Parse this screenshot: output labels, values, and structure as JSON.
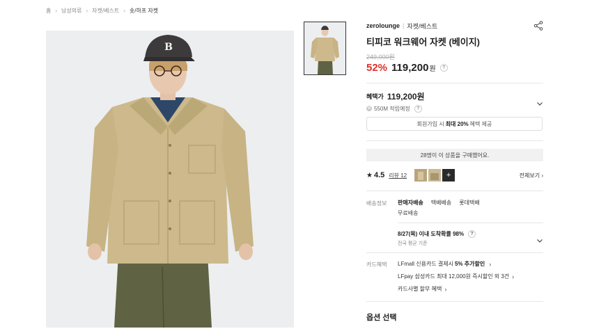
{
  "breadcrumb": [
    "홈",
    "남성의류",
    "자켓/베스트",
    "숏/하프 자켓"
  ],
  "product": {
    "brand": "zerolounge",
    "category": "자켓/베스트",
    "title": "티피코 워크웨어 자켓 (베이지)",
    "original_price": "249,000원",
    "discount": "52%",
    "price": "119,200",
    "currency": "원"
  },
  "benefit": {
    "label": "혜택가",
    "price": "119,200원",
    "points": "550M 적립예정",
    "member_text_pre": "회원가입 시",
    "member_text_bold": "최대 20%",
    "member_text_post": "혜택 제공"
  },
  "purchase_count_text": "28명이 이 상품을 구매했어요.",
  "reviews": {
    "rating": "4.5",
    "link": "리뷰 12",
    "more": "+",
    "see_all": "전체보기 ›"
  },
  "shipping": {
    "label": "배송정보",
    "methods": [
      "판매자배송",
      "택배배송",
      "롯데택배"
    ],
    "fee": "무료배송",
    "arrival": "8/27(목) 이내 도착확률 98%",
    "arrival_sub": "전국 평균 기준"
  },
  "card": {
    "label": "카드혜택",
    "line1_pre": "LFmall 신용카드 결제시",
    "line1_bold": "5% 추가할인",
    "line2": "LFpay 삼성카드 최대 12,000원 즉시할인 외 3건",
    "line3": "카드사별 할부 혜택"
  },
  "options_title": "옵션 선택",
  "colors": {
    "discount": "#e0302b",
    "jacket": "#cdb98b",
    "pants": "#5e6243"
  },
  "icons": {
    "share": "share-icon",
    "help": "help-icon",
    "chevron": "chevron-down-icon"
  }
}
